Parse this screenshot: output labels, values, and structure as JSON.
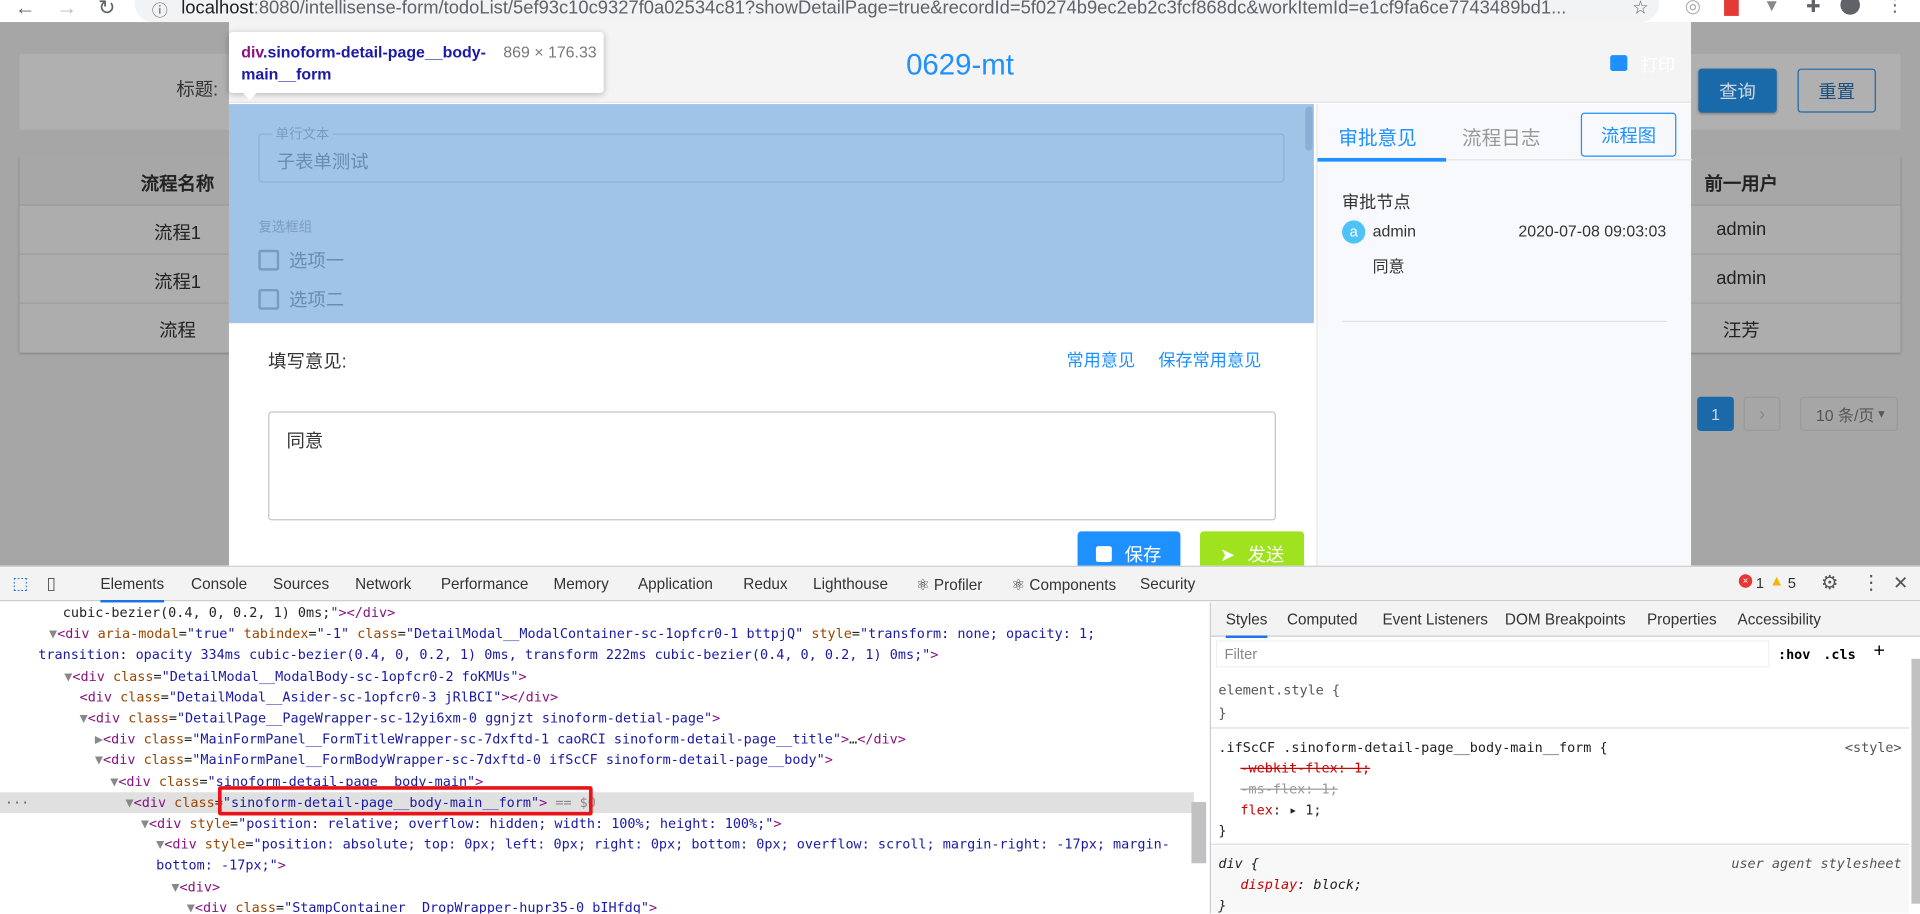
{
  "browser": {
    "url_host": "localhost",
    "url_rest": ":8080/intellisense-form/todoList/5ef93c10c9327f0a02534c81?showDetailPage=true&recordId=5f0274b9ec2eb2c3fcf868dc&workItemId=e1cf9fa6ce7743489bd1...",
    "icons": [
      "back-icon",
      "forward-icon",
      "reload-icon",
      "info-icon",
      "star-icon",
      "extension-icon",
      "profile-icon",
      "menu-icon"
    ]
  },
  "page": {
    "search_label": "标题:",
    "query_button": "查询",
    "reset_button": "重置",
    "table": {
      "columns": [
        "流程名称",
        "前一用户"
      ],
      "rows": [
        [
          "流程1",
          "admin"
        ],
        [
          "流程1",
          "admin"
        ],
        [
          "流程",
          "汪芳"
        ]
      ]
    },
    "pagination": {
      "current": "1",
      "next": "›",
      "page_size": "10 条/页"
    }
  },
  "modal": {
    "title": "0629-mt",
    "print_label": "打印",
    "form": {
      "text_field_label": "单行文本",
      "text_field_value": "子表单测试",
      "checkbox_group_label": "复选框组",
      "checkbox_options": [
        "选项一",
        "选项二"
      ]
    },
    "opinion": {
      "label": "填写意见:",
      "common_link": "常用意见",
      "save_common_link": "保存常用意见",
      "value": "同意",
      "save_button": "保存",
      "send_button": "发送"
    },
    "side": {
      "tabs": [
        "审批意见",
        "流程日志"
      ],
      "flowchart_button": "流程图",
      "node_title": "审批节点",
      "avatar_letter": "a",
      "user": "admin",
      "time": "2020-07-08 09:03:03",
      "comment": "同意"
    }
  },
  "tooltip": {
    "tag": "div",
    "class_line1": ".sinoform-detail-page__body-",
    "class_line2": "main__form",
    "size": "869 × 176.33"
  },
  "devtools": {
    "tabs": [
      "Elements",
      "Console",
      "Sources",
      "Network",
      "Performance",
      "Memory",
      "Application",
      "Redux",
      "Lighthouse",
      "⚛ Profiler",
      "⚛ Components",
      "Security"
    ],
    "active_tab": "Elements",
    "errors": "1",
    "warnings": "5",
    "dom_lines": [
      {
        "depth": 0.9,
        "arrow": "",
        "tokens": [
          [
            "plain",
            "cubic-bezier(0.4, 0, 0.2, 1) 0ms;"
          ],
          [
            "tag",
            "\"></div>"
          ]
        ]
      },
      {
        "depth": 0,
        "arrow": "▼",
        "tokens": [
          [
            "tag",
            "<div "
          ],
          [
            "attr",
            "aria-modal"
          ],
          [
            "plain",
            "="
          ],
          [
            "val",
            "\"true\" "
          ],
          [
            "attr",
            "tabindex"
          ],
          [
            "plain",
            "="
          ],
          [
            "val",
            "\"-1\" "
          ],
          [
            "attr",
            "class"
          ],
          [
            "plain",
            "="
          ],
          [
            "val",
            "\"DetailModal__ModalContainer-sc-1opfcr0-1 bttpjQ\" "
          ],
          [
            "attr",
            "style"
          ],
          [
            "plain",
            "="
          ],
          [
            "val",
            "\"transform: none; opacity: 1;"
          ]
        ]
      },
      {
        "depth": -0.7,
        "arrow": "",
        "tokens": [
          [
            "val",
            "transition: opacity 334ms cubic-bezier(0.4, 0, 0.2, 1) 0ms, transform 222ms cubic-bezier(0.4, 0, 0.2, 1) 0ms;\""
          ],
          [
            "tag",
            ">"
          ]
        ]
      },
      {
        "depth": 1,
        "arrow": "▼",
        "tokens": [
          [
            "tag",
            "<div "
          ],
          [
            "attr",
            "class"
          ],
          [
            "plain",
            "="
          ],
          [
            "val",
            "\"DetailModal__ModalBody-sc-1opfcr0-2 foKMUs\""
          ],
          [
            "tag",
            ">"
          ]
        ]
      },
      {
        "depth": 2,
        "arrow": "",
        "tokens": [
          [
            "tag",
            "<div "
          ],
          [
            "attr",
            "class"
          ],
          [
            "plain",
            "="
          ],
          [
            "val",
            "\"DetailModal__Asider-sc-1opfcr0-3 jRlBCI\""
          ],
          [
            "tag",
            "></div>"
          ]
        ]
      },
      {
        "depth": 2,
        "arrow": "▼",
        "tokens": [
          [
            "tag",
            "<div "
          ],
          [
            "attr",
            "class"
          ],
          [
            "plain",
            "="
          ],
          [
            "val",
            "\"DetailPage__PageWrapper-sc-12yi6xm-0 ggnjzt sinoform-detial-page\""
          ],
          [
            "tag",
            ">"
          ]
        ]
      },
      {
        "depth": 3,
        "arrow": "▶",
        "tokens": [
          [
            "tag",
            "<div "
          ],
          [
            "attr",
            "class"
          ],
          [
            "plain",
            "="
          ],
          [
            "val",
            "\"MainFormPanel__FormTitleWrapper-sc-7dxftd-1 caoRCI sinoform-detail-page__title\""
          ],
          [
            "tag",
            ">"
          ],
          [
            "plain",
            "…"
          ],
          [
            "tag",
            "</div>"
          ]
        ]
      },
      {
        "depth": 3,
        "arrow": "▼",
        "tokens": [
          [
            "tag",
            "<div "
          ],
          [
            "attr",
            "class"
          ],
          [
            "plain",
            "="
          ],
          [
            "val",
            "\"MainFormPanel__FormBodyWrapper-sc-7dxftd-0 ifScCF sinoform-detail-page__body\""
          ],
          [
            "tag",
            ">"
          ]
        ]
      },
      {
        "depth": 4,
        "arrow": "▼",
        "tokens": [
          [
            "tag",
            "<div "
          ],
          [
            "attr",
            "class"
          ],
          [
            "plain",
            "="
          ],
          [
            "val",
            "\"sinoform-detail-page__body-main\""
          ],
          [
            "tag",
            ">"
          ]
        ]
      },
      {
        "depth": 5,
        "arrow": "▼",
        "selected": true,
        "tokens": [
          [
            "tag",
            "<div "
          ],
          [
            "attr",
            "class"
          ],
          [
            "plain",
            "="
          ],
          [
            "val",
            "\"sinoform-detail-page__body-main__form\""
          ],
          [
            "tag",
            ">"
          ],
          [
            "dim",
            " == $0"
          ]
        ]
      },
      {
        "depth": 6,
        "arrow": "▼",
        "tokens": [
          [
            "tag",
            "<div "
          ],
          [
            "attr",
            "style"
          ],
          [
            "plain",
            "="
          ],
          [
            "val",
            "\"position: relative; overflow: hidden; width: 100%; height: 100%;\""
          ],
          [
            "tag",
            ">"
          ]
        ]
      },
      {
        "depth": 7,
        "arrow": "▼",
        "tokens": [
          [
            "tag",
            "<div "
          ],
          [
            "attr",
            "style"
          ],
          [
            "plain",
            "="
          ],
          [
            "val",
            "\"position: absolute; top: 0px; left: 0px; right: 0px; bottom: 0px; overflow: scroll; margin-right: -17px; margin-"
          ]
        ]
      },
      {
        "depth": 7,
        "arrow": "",
        "tokens": [
          [
            "val",
            "bottom: -17px;\""
          ],
          [
            "tag",
            ">"
          ]
        ]
      },
      {
        "depth": 8,
        "arrow": "▼",
        "tokens": [
          [
            "tag",
            "<div>"
          ]
        ]
      },
      {
        "depth": 9,
        "arrow": "▼",
        "tokens": [
          [
            "tag",
            "<div "
          ],
          [
            "attr",
            "class"
          ],
          [
            "plain",
            "="
          ],
          [
            "val",
            "\"StampContainer__DropWrapper-hupr35-0 bIHfdq\""
          ],
          [
            "tag",
            ">"
          ]
        ]
      }
    ],
    "styles_tabs": [
      "Styles",
      "Computed",
      "Event Listeners",
      "DOM Breakpoints",
      "Properties",
      "Accessibility"
    ],
    "filter_placeholder": "Filter",
    "hov": ":hov",
    "cls": ".cls",
    "rules": {
      "element_style": "element.style {",
      "close": "}",
      "rule1_selector": ".ifScCF .sinoform-detail-page__body-main__form {",
      "rule1_source": "<style>",
      "rule1_p1": "-webkit-flex: 1;",
      "rule1_p2": "-ms-flex: 1;",
      "rule1_p3_name": "flex",
      "rule1_p3_value": "1;",
      "rule2_selector": "div {",
      "rule2_source": "user agent stylesheet",
      "rule2_p1_name": "display",
      "rule2_p1_value": "block;"
    }
  },
  "colors": {
    "accent": "#1e90ff",
    "send": "#9fe21f",
    "form_highlight": "#a0c4e8",
    "query": "#1a69a8",
    "error": "#e53935",
    "warning": "#f4b400"
  }
}
